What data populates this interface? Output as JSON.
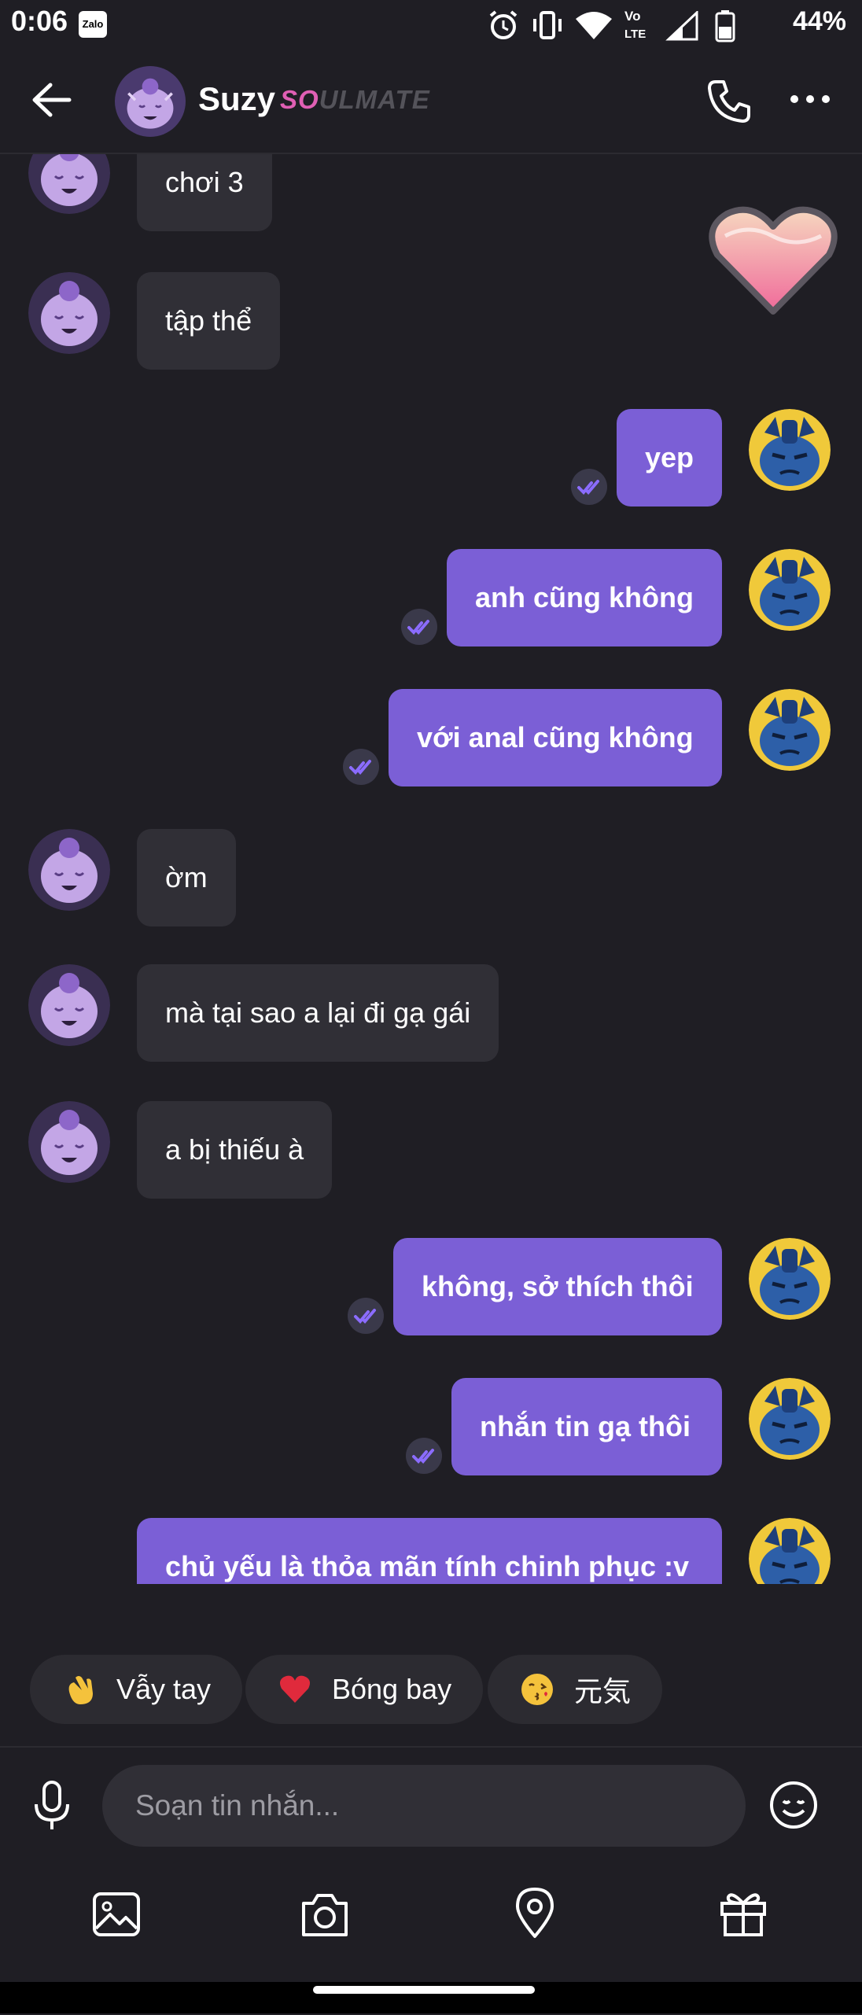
{
  "status_bar": {
    "time": "0:06",
    "battery": "44%",
    "zalo_label": "Zalo"
  },
  "header": {
    "contact_name": "Suzy",
    "badge_so": "SO",
    "badge_rest": "ULMATE"
  },
  "messages": {
    "m1": "chơi 3",
    "m2": "tập thể",
    "m3": "yep",
    "m4": "anh cũng không",
    "m5": "với anal cũng không",
    "m6": "ờm",
    "m7": "mà tại sao a lại đi gạ gái",
    "m8": "a bị thiếu à",
    "m9": "không, sở thích thôi",
    "m10": "nhắn tin gạ thôi",
    "m11": "chủ yếu là thỏa mãn tính chinh phục :v"
  },
  "quick_replies": {
    "wave": "Vẫy tay",
    "balloon": "Bóng bay",
    "genki": "元気"
  },
  "composer": {
    "placeholder": "Soạn tin nhắn..."
  },
  "colors": {
    "accent": "#7b5fd6",
    "background": "#1f1e24",
    "incoming": "#302f36"
  }
}
